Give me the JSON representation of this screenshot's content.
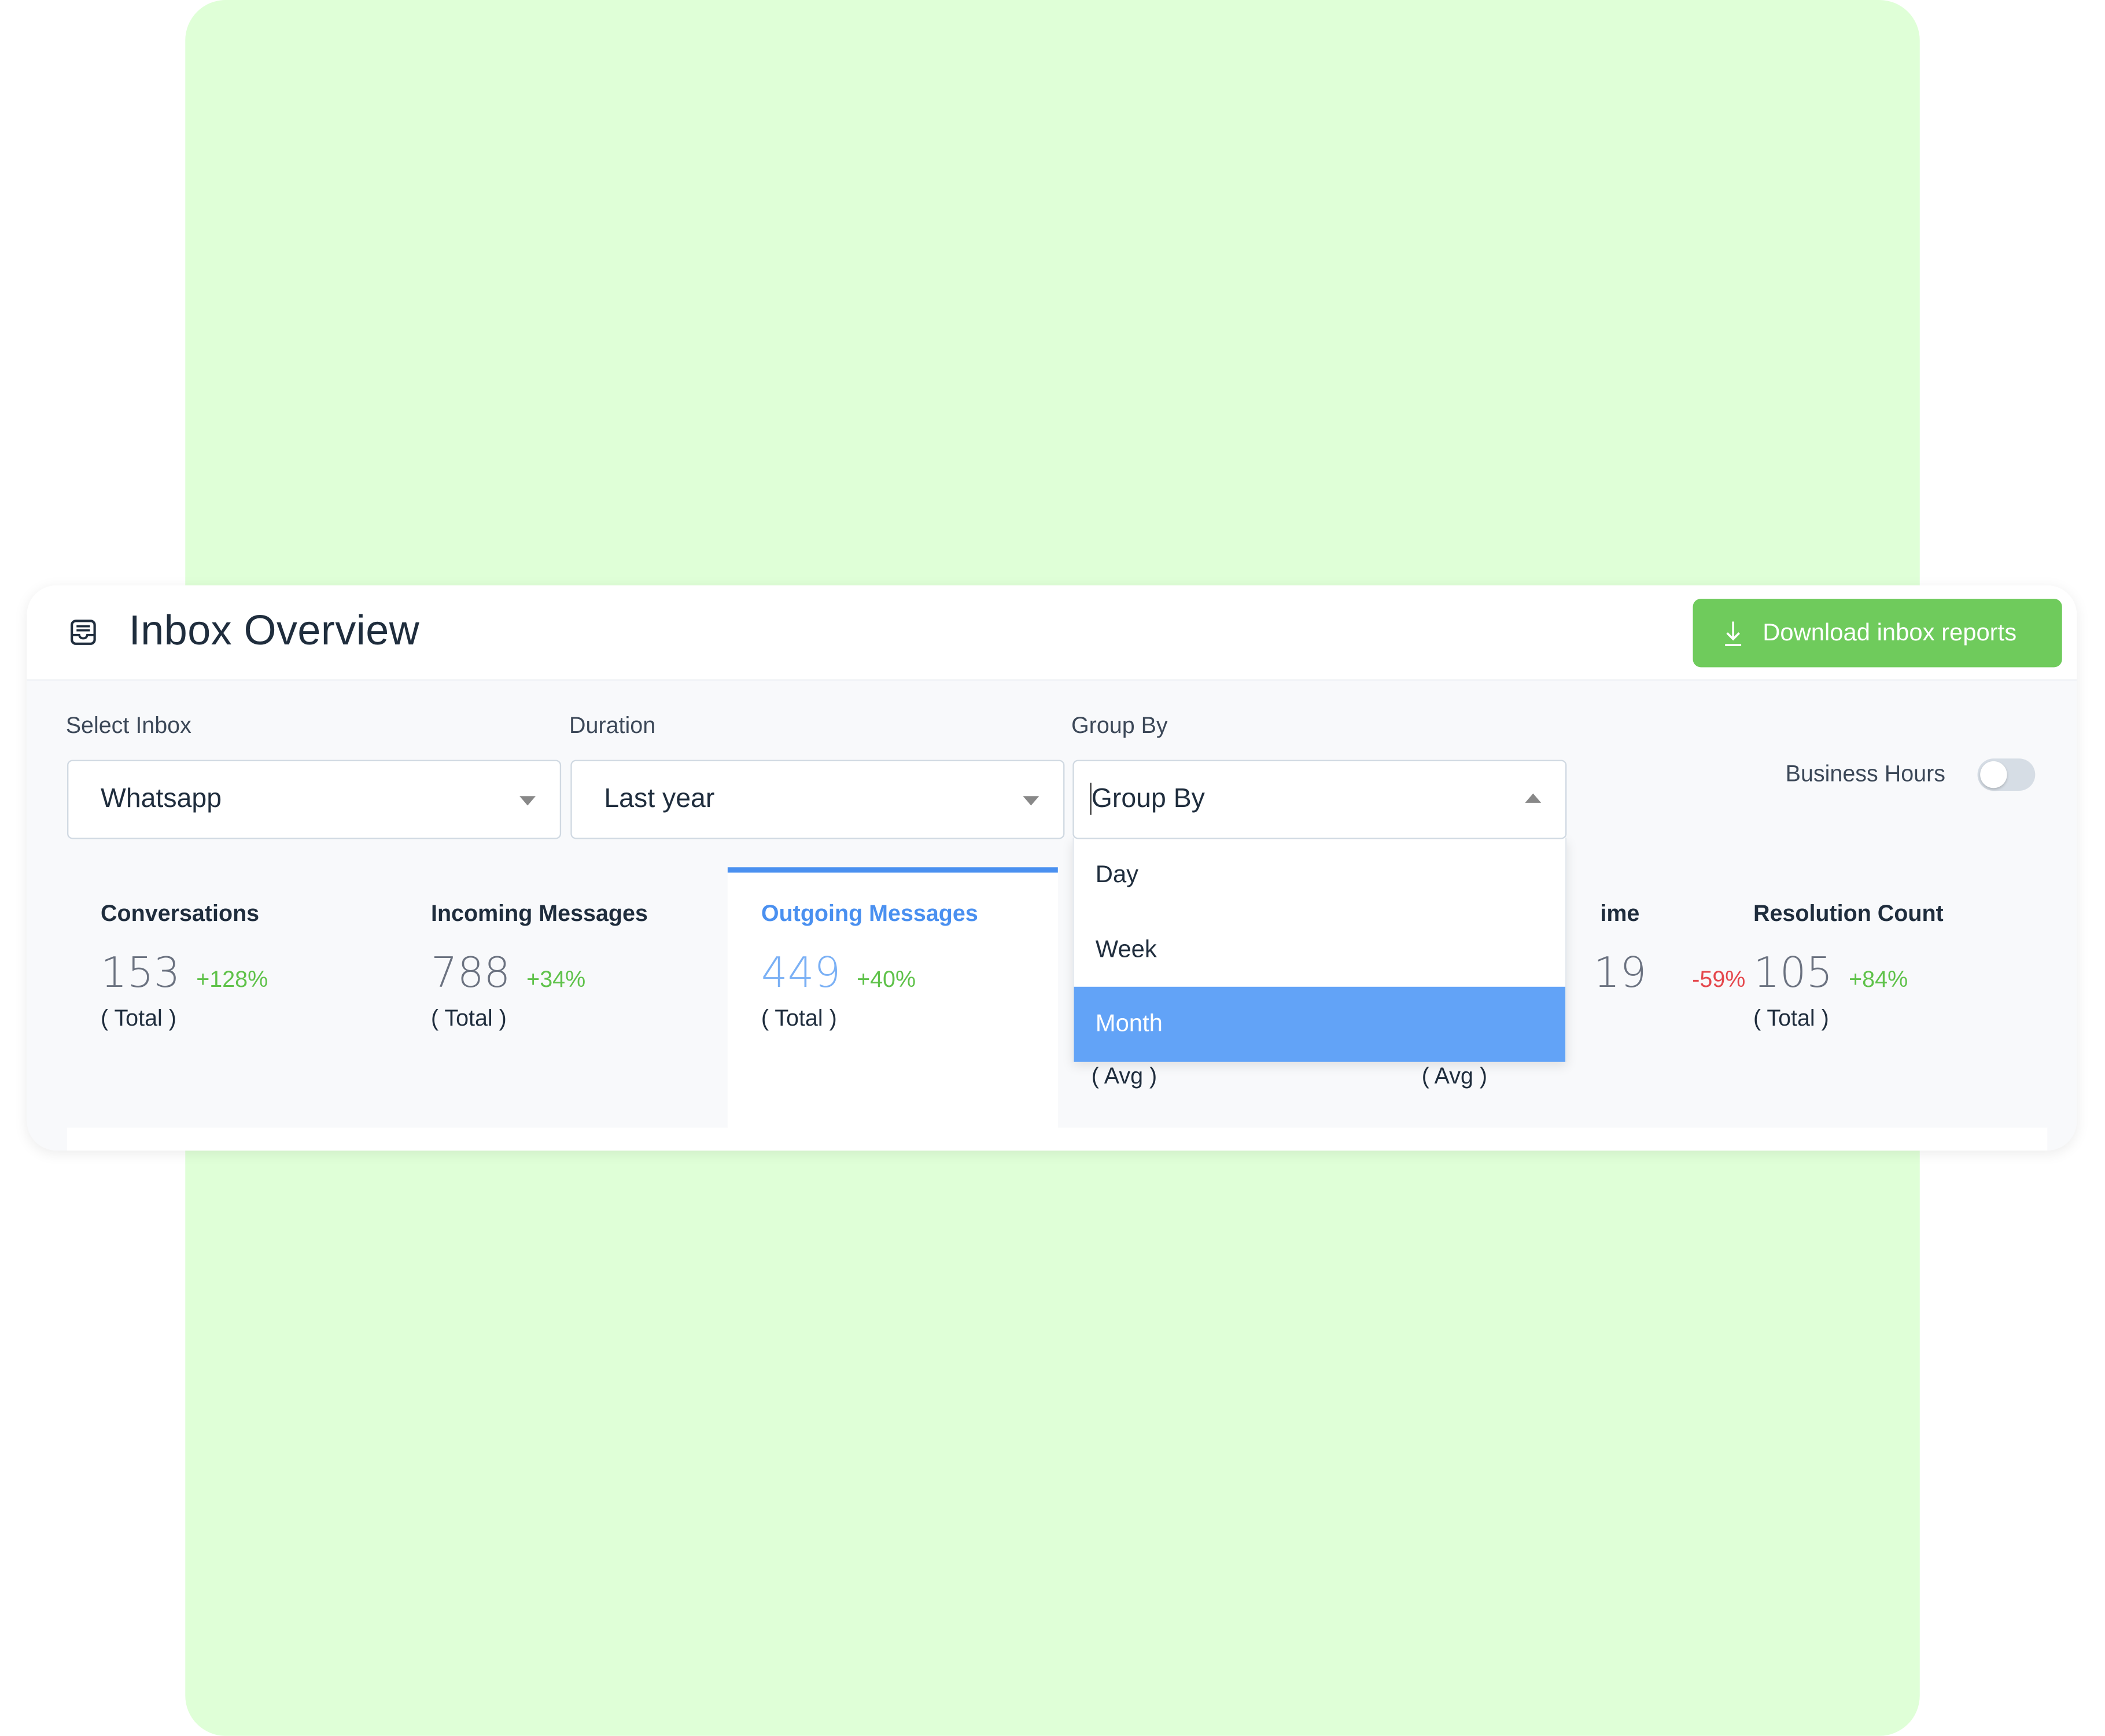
{
  "header": {
    "title": "Inbox Overview",
    "icon": "inbox-tray-icon",
    "download_label": "Download inbox reports",
    "download_icon": "download-icon"
  },
  "filters": {
    "inbox": {
      "label": "Select Inbox",
      "value": "Whatsapp"
    },
    "duration": {
      "label": "Duration",
      "value": "Last year"
    },
    "group_by": {
      "label": "Group By",
      "placeholder": "Group By",
      "options": [
        "Day",
        "Week",
        "Month"
      ],
      "highlighted": "Month",
      "open": true
    },
    "business_hours": {
      "label": "Business Hours",
      "enabled": false
    }
  },
  "metrics": [
    {
      "title": "Conversations",
      "value": "153",
      "change": "+128%",
      "subtitle": "( Total )"
    },
    {
      "title": "Incoming Messages",
      "value": "788",
      "change": "+34%",
      "subtitle": "( Total )"
    },
    {
      "title": "Outgoing Messages",
      "value": "449",
      "change": "+40%",
      "subtitle": "( Total )",
      "active": true
    },
    {
      "subtitle": "( Avg )"
    },
    {
      "title": "ime",
      "value": "19",
      "change": "-59%",
      "subtitle": "( Avg )"
    },
    {
      "title": "Resolution Count",
      "value": "105",
      "change": "+84%",
      "subtitle": "( Total )"
    }
  ],
  "colors": {
    "accent": "#4a90f0",
    "button": "#6fcb5c",
    "positive": "#5fc24a",
    "negative": "#e5484d",
    "highlight": "#62a3f7",
    "background": "#dfffd7"
  }
}
